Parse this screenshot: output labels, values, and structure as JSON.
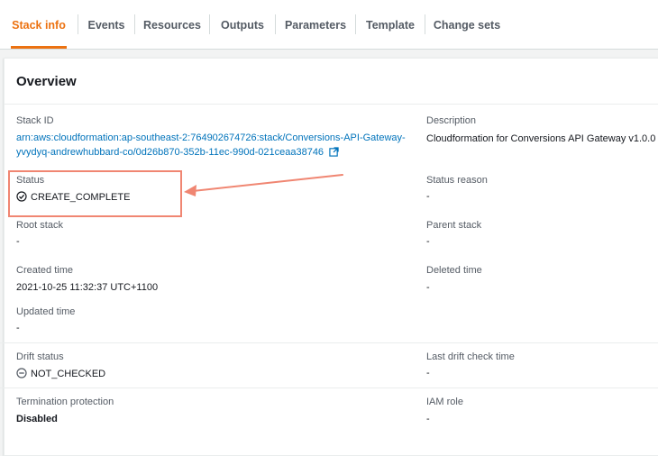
{
  "tabs": [
    {
      "label": "Stack info",
      "active": true
    },
    {
      "label": "Events"
    },
    {
      "label": "Resources"
    },
    {
      "label": "Outputs"
    },
    {
      "label": "Parameters"
    },
    {
      "label": "Template"
    },
    {
      "label": "Change sets"
    }
  ],
  "overview": {
    "title": "Overview",
    "stack_id": {
      "label": "Stack ID",
      "line1": "arn:aws:cloudformation:ap-southeast-2:764902674726:stack/Conversions-API-Gateway-",
      "line2": "yvydyq-andrewhubbard-co/0d26b870-352b-11ec-990d-021ceaa38746"
    },
    "description": {
      "label": "Description",
      "value": "Cloudformation for Conversions API Gateway v1.0.0"
    },
    "status": {
      "label": "Status",
      "value": "CREATE_COMPLETE"
    },
    "status_reason": {
      "label": "Status reason",
      "value": "-"
    },
    "root_stack": {
      "label": "Root stack",
      "value": "-"
    },
    "parent_stack": {
      "label": "Parent stack",
      "value": "-"
    },
    "created_time": {
      "label": "Created time",
      "value": "2021-10-25 11:32:37 UTC+1100"
    },
    "deleted_time": {
      "label": "Deleted time",
      "value": "-"
    },
    "updated_time": {
      "label": "Updated time",
      "value": "-"
    },
    "drift_status": {
      "label": "Drift status",
      "value": "NOT_CHECKED"
    },
    "last_drift_check": {
      "label": "Last drift check time",
      "value": "-"
    },
    "termination_protection": {
      "label": "Termination protection",
      "value": "Disabled"
    },
    "iam_role": {
      "label": "IAM role",
      "value": "-"
    }
  },
  "colors": {
    "accent": "#ec7211",
    "link": "#0073bb",
    "annotation": "#f08672"
  },
  "icons": {
    "external": "external-link-icon",
    "status": "check-circle-icon",
    "drift": "minus-circle-icon"
  }
}
